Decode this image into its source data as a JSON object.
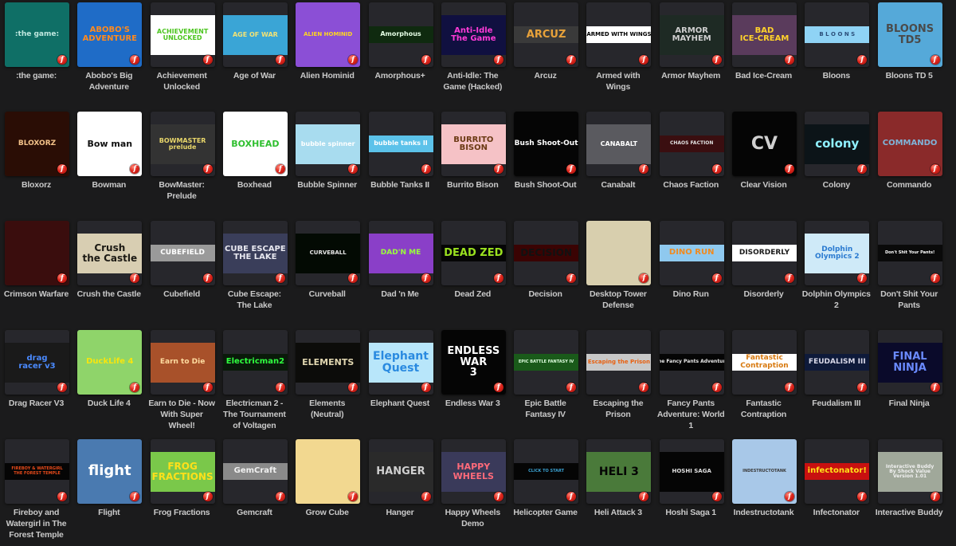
{
  "theme": {
    "background": "#1b1b1c",
    "tile": "#27272c",
    "label": "#c9c9c9",
    "flash_badge": "#e0261c"
  },
  "badge_icon": "flash-player-icon",
  "badge_glyph": "f",
  "games": [
    {
      "title": ":the game:",
      "art": {
        "text": ":the game:",
        "bg": "#0f6f66",
        "fg": "#bfe8e0",
        "style": "full",
        "size": 9
      }
    },
    {
      "title": "Abobo's Big Adventure",
      "art": {
        "text": "ABOBO'S\nADVENTURE",
        "bg": "#1f6cc7",
        "fg": "#ff8a1e",
        "style": "full",
        "size": 10
      }
    },
    {
      "title": "Achievement Unlocked",
      "art": {
        "text": "ACHIEVEMENT\nUNLOCKED",
        "bg": "#ffffff",
        "fg": "#4cc51f",
        "style": "band",
        "size": 8
      }
    },
    {
      "title": "Age of War",
      "art": {
        "text": "AGE OF WAR",
        "bg": "#3aa5d6",
        "fg": "#f2e276",
        "style": "band",
        "size": 8
      }
    },
    {
      "title": "Alien Hominid",
      "art": {
        "text": "ALIEN HOMINID",
        "bg": "#8b4fd6",
        "fg": "#ffd71f",
        "style": "full",
        "size": 7
      }
    },
    {
      "title": "Amorphous+",
      "art": {
        "text": "Amorphous",
        "bg": "#0f2a0f",
        "fg": "#e6ffe6",
        "style": "thin",
        "size": 8
      }
    },
    {
      "title": "Anti-Idle: The Game (Hacked)",
      "art": {
        "text": "Anti-Idle\nThe Game",
        "bg": "#101040",
        "fg": "#ff3bd9",
        "style": "band",
        "size": 10
      }
    },
    {
      "title": "Arcuz",
      "art": {
        "text": "ARCUZ",
        "bg": "#3a3a3a",
        "fg": "#e8a23a",
        "style": "thin",
        "size": 13
      }
    },
    {
      "title": "Armed with Wings",
      "art": {
        "text": "ARMED WITH WINGS",
        "bg": "#ffffff",
        "fg": "#000000",
        "style": "thin",
        "size": 7
      }
    },
    {
      "title": "Armor Mayhem",
      "art": {
        "text": "ARMOR\nMAYHEM",
        "bg": "#1e2a24",
        "fg": "#cfcfcf",
        "style": "band",
        "size": 10
      }
    },
    {
      "title": "Bad Ice-Cream",
      "art": {
        "text": "BAD\nICE-CREAM",
        "bg": "#5a3b5c",
        "fg": "#ffd22b",
        "style": "band",
        "size": 10
      }
    },
    {
      "title": "Bloons",
      "art": {
        "text": "B L O O N S",
        "bg": "#8fd3f5",
        "fg": "#2c4f7a",
        "style": "thin",
        "size": 7
      }
    },
    {
      "title": "Bloons TD 5",
      "art": {
        "text": "BLOONS\nTD5",
        "bg": "#55a9d9",
        "fg": "#4a4a4a",
        "style": "full",
        "size": 13
      }
    },
    {
      "title": "Bloxorz",
      "art": {
        "text": "BLOXORZ",
        "bg": "#2a0d05",
        "fg": "#f5c38a",
        "style": "full",
        "size": 9
      }
    },
    {
      "title": "Bowman",
      "art": {
        "text": "Bow man",
        "bg": "#ffffff",
        "fg": "#111111",
        "style": "full",
        "size": 11
      }
    },
    {
      "title": "BowMaster: Prelude",
      "art": {
        "text": "BOWMASTER\nprelude",
        "bg": "#333333",
        "fg": "#e8d66a",
        "style": "band",
        "size": 8
      }
    },
    {
      "title": "Boxhead",
      "art": {
        "text": "BOXHEAD",
        "bg": "#ffffff",
        "fg": "#2fbf2f",
        "style": "full",
        "size": 11
      }
    },
    {
      "title": "Bubble Spinner",
      "art": {
        "text": "bubble spinner",
        "bg": "#a8dcef",
        "fg": "#ffffff",
        "style": "band",
        "size": 8
      }
    },
    {
      "title": "Bubble Tanks II",
      "art": {
        "text": "bubble tanks II",
        "bg": "#5cc2ea",
        "fg": "#ffffff",
        "style": "thin",
        "size": 8
      }
    },
    {
      "title": "Burrito Bison",
      "art": {
        "text": "BURRITO\nBISON",
        "bg": "#f5c2c6",
        "fg": "#6b3a14",
        "style": "band",
        "size": 10
      }
    },
    {
      "title": "Bush Shoot-Out",
      "art": {
        "text": "Bush Shoot-Out",
        "bg": "#050505",
        "fg": "#ffffff",
        "style": "full",
        "size": 9
      }
    },
    {
      "title": "Canabalt",
      "art": {
        "text": "CANABALT",
        "bg": "#5a5a5f",
        "fg": "#ffffff",
        "style": "band",
        "size": 8
      }
    },
    {
      "title": "Chaos Faction",
      "art": {
        "text": "CHAOS FACTION",
        "bg": "#3a0e10",
        "fg": "#e0e0e0",
        "style": "thin",
        "size": 6
      }
    },
    {
      "title": "Clear Vision",
      "art": {
        "text": "CV",
        "bg": "#050505",
        "fg": "#d0d0d0",
        "style": "full",
        "size": 22
      }
    },
    {
      "title": "Colony",
      "art": {
        "text": "colony",
        "bg": "#0c1418",
        "fg": "#8ff0ff",
        "style": "band",
        "size": 15
      }
    },
    {
      "title": "Commando",
      "art": {
        "text": "COMMANDO",
        "bg": "#8a2a2a",
        "fg": "#7fb4d9",
        "style": "full",
        "size": 10
      }
    },
    {
      "title": "Crimson Warfare",
      "art": {
        "text": "",
        "bg": "#3a0d0d",
        "fg": "#b02020",
        "style": "full",
        "size": 8
      }
    },
    {
      "title": "Crush the Castle",
      "art": {
        "text": "Crush\nthe Castle",
        "bg": "#d8ceb2",
        "fg": "#1c1a14",
        "style": "band",
        "size": 12
      }
    },
    {
      "title": "Cubefield",
      "art": {
        "text": "CUBEFIELD",
        "bg": "#9a9a9a",
        "fg": "#ffffff",
        "style": "thin",
        "size": 9
      }
    },
    {
      "title": "Cube Escape: The Lake",
      "art": {
        "text": "CUBE ESCAPE\nTHE LAKE",
        "bg": "#3a3e5a",
        "fg": "#e8e8f0",
        "style": "band",
        "size": 10
      }
    },
    {
      "title": "Curveball",
      "art": {
        "text": "CURVEBALL",
        "bg": "#030a03",
        "fg": "#e8e8e8",
        "style": "band",
        "size": 7
      }
    },
    {
      "title": "Dad 'n Me",
      "art": {
        "text": "DAD'N ME",
        "bg": "#8a3fc8",
        "fg": "#9aff3a",
        "style": "band",
        "size": 9
      }
    },
    {
      "title": "Dead Zed",
      "art": {
        "text": "DEAD ZED",
        "bg": "#050505",
        "fg": "#9ae11f",
        "style": "thin",
        "size": 13
      }
    },
    {
      "title": "Decision",
      "art": {
        "text": "DECISION",
        "bg": "#3a0303",
        "fg": "#111111",
        "style": "thin",
        "size": 12
      }
    },
    {
      "title": "Desktop Tower Defense",
      "art": {
        "text": "",
        "bg": "#d8cfae",
        "fg": "#555555",
        "style": "full",
        "size": 8
      }
    },
    {
      "title": "Dino Run",
      "art": {
        "text": "DINO RUN",
        "bg": "#8fc9ef",
        "fg": "#f08a1f",
        "style": "thin",
        "size": 10
      }
    },
    {
      "title": "Disorderly",
      "art": {
        "text": "DISORDERLY",
        "bg": "#ffffff",
        "fg": "#1a1a1a",
        "style": "thin",
        "size": 9
      }
    },
    {
      "title": "Dolphin Olympics 2",
      "art": {
        "text": "Dolphin\nOlympics 2",
        "bg": "#cfeaf8",
        "fg": "#2a7ad0",
        "style": "band",
        "size": 9
      }
    },
    {
      "title": "Don't Shit Your Pants",
      "art": {
        "text": "Don't Shit Your Pants!",
        "bg": "#0a0a0a",
        "fg": "#ffffff",
        "style": "thin",
        "size": 5
      }
    },
    {
      "title": "Drag Racer V3",
      "art": {
        "text": "drag\nracer v3",
        "bg": "#1a1a1a",
        "fg": "#4a8aff",
        "style": "band",
        "size": 10
      }
    },
    {
      "title": "Duck Life 4",
      "art": {
        "text": "DuckLife 4",
        "bg": "#8fd46a",
        "fg": "#f6e50f",
        "style": "full",
        "size": 10
      }
    },
    {
      "title": "Earn to Die - Now With Super Wheel!",
      "art": {
        "text": "Earn to Die",
        "bg": "#a8512a",
        "fg": "#ffdca0",
        "style": "band",
        "size": 9
      }
    },
    {
      "title": "Electricman 2 - The Tournament of Voltagen",
      "art": {
        "text": "Electricman2",
        "bg": "#0a1a0a",
        "fg": "#2fff3f",
        "style": "thin",
        "size": 10
      }
    },
    {
      "title": "Elements (Neutral)",
      "art": {
        "text": "ELEMENTS",
        "bg": "#0c0c0a",
        "fg": "#e0d6b0",
        "style": "band",
        "size": 11
      }
    },
    {
      "title": "Elephant Quest",
      "art": {
        "text": "Elephant\nQuest",
        "bg": "#b8e6fa",
        "fg": "#2a8ae0",
        "style": "band",
        "size": 14
      }
    },
    {
      "title": "Endless War 3",
      "art": {
        "text": "ENDLESS\nWAR\n3",
        "bg": "#050505",
        "fg": "#ffffff",
        "style": "full",
        "size": 13
      }
    },
    {
      "title": "Epic Battle Fantasy IV",
      "art": {
        "text": "EPIC BATTLE FANTASY IV",
        "bg": "#1a5a1a",
        "fg": "#e0ffe0",
        "style": "thin",
        "size": 5
      }
    },
    {
      "title": "Escaping the Prison",
      "art": {
        "text": "Escaping the Prison",
        "bg": "#c8c8c8",
        "fg": "#e86010",
        "style": "thin",
        "size": 7
      }
    },
    {
      "title": "Fancy Pants Adventure: World 1",
      "art": {
        "text": "The Fancy Pants Adventure",
        "bg": "#050505",
        "fg": "#e8e8e8",
        "style": "thin",
        "size": 6
      }
    },
    {
      "title": "Fantastic Contraption",
      "art": {
        "text": "Fantastic\nContraption",
        "bg": "#ffffff",
        "fg": "#d87a10",
        "style": "thin",
        "size": 9
      }
    },
    {
      "title": "Feudalism III",
      "art": {
        "text": "FEUDALISM III",
        "bg": "#0e1a3a",
        "fg": "#d8d8e8",
        "style": "thin",
        "size": 9
      }
    },
    {
      "title": "Final Ninja",
      "art": {
        "text": "FINAL\nNINJA",
        "bg": "#0a0a2a",
        "fg": "#6a8aff",
        "style": "band",
        "size": 13
      }
    },
    {
      "title": "Fireboy and Watergirl in The Forest Temple",
      "art": {
        "text": "FIREBOY & WATERGIRL\nTHE FOREST TEMPLE",
        "bg": "#050505",
        "fg": "#e84a1a",
        "style": "thin",
        "size": 5
      }
    },
    {
      "title": "Flight",
      "art": {
        "text": "flight",
        "bg": "#4a7ab0",
        "fg": "#ffffff",
        "style": "full",
        "size": 18
      }
    },
    {
      "title": "Frog Fractions",
      "art": {
        "text": "FROG\nFRACTIONS",
        "bg": "#7ac84a",
        "fg": "#ffe01a",
        "style": "band",
        "size": 12
      }
    },
    {
      "title": "Gemcraft",
      "art": {
        "text": "GemCraft",
        "bg": "#8a8a8a",
        "fg": "#f0f0f0",
        "style": "thin",
        "size": 10
      }
    },
    {
      "title": "Grow Cube",
      "art": {
        "text": "",
        "bg": "#f2d890",
        "fg": "#8a5a2a",
        "style": "full",
        "size": 8
      }
    },
    {
      "title": "Hanger",
      "art": {
        "text": "HANGER",
        "bg": "#2a2a2a",
        "fg": "#d0d0d0",
        "style": "band",
        "size": 13
      }
    },
    {
      "title": "Happy Wheels Demo",
      "art": {
        "text": "HAPPY\nWHEELS",
        "bg": "#3a3a5a",
        "fg": "#ff6a7a",
        "style": "band",
        "size": 11
      }
    },
    {
      "title": "Helicopter Game",
      "art": {
        "text": "CLICK TO START",
        "bg": "#050505",
        "fg": "#3aa0d0",
        "style": "thin",
        "size": 5
      }
    },
    {
      "title": "Heli Attack 3",
      "art": {
        "text": "HELI 3",
        "bg": "#4a7a3a",
        "fg": "#050505",
        "style": "band",
        "size": 14
      }
    },
    {
      "title": "Hoshi Saga 1",
      "art": {
        "text": "HOSHI SAGA",
        "bg": "#050505",
        "fg": "#e0e0e0",
        "style": "band",
        "size": 7
      }
    },
    {
      "title": "Indestructotank",
      "art": {
        "text": "INDESTRUCTOTANK",
        "bg": "#a8c8e8",
        "fg": "#3a3a3a",
        "style": "full",
        "size": 5
      }
    },
    {
      "title": "Infectonator",
      "art": {
        "text": "infectonator!",
        "bg": "#c81010",
        "fg": "#ffe01a",
        "style": "thin",
        "size": 10
      }
    },
    {
      "title": "Interactive Buddy",
      "art": {
        "text": "Interactive Buddy\nBy Shock Value\nVersion 1.01",
        "bg": "#a0a89a",
        "fg": "#f0f0f0",
        "style": "band",
        "size": 6
      }
    }
  ]
}
